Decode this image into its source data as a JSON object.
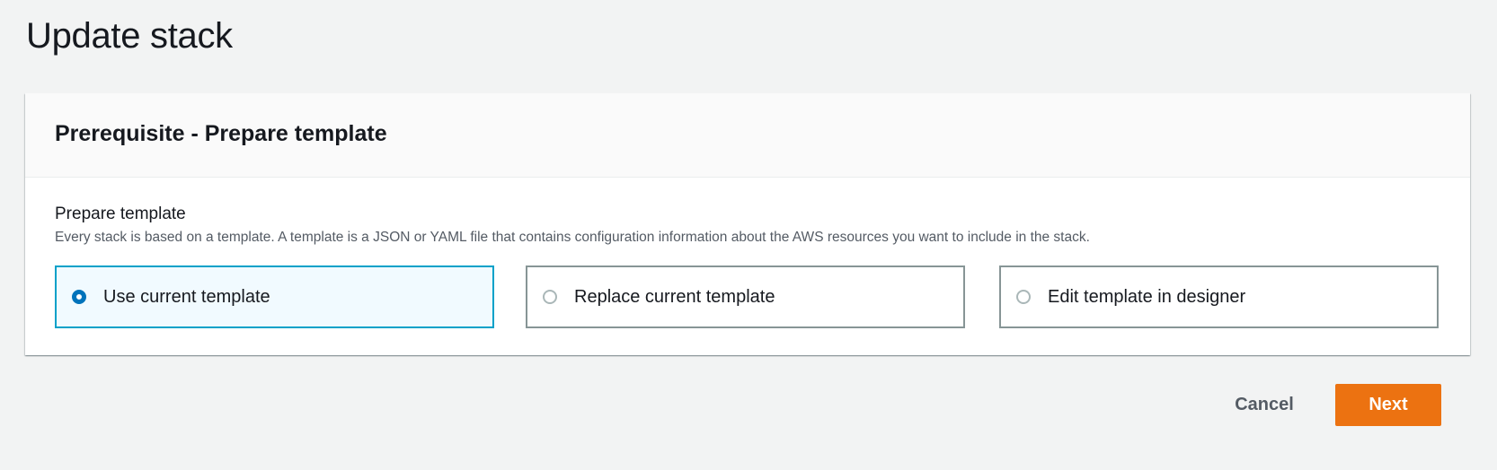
{
  "page": {
    "title": "Update stack"
  },
  "card": {
    "header": "Prerequisite - Prepare template",
    "field_label": "Prepare template",
    "field_description": "Every stack is based on a template. A template is a JSON or YAML file that contains configuration information about the AWS resources you want to include in the stack.",
    "options": [
      {
        "label": "Use current template",
        "selected": true
      },
      {
        "label": "Replace current template",
        "selected": false
      },
      {
        "label": "Edit template in designer",
        "selected": false
      }
    ]
  },
  "actions": {
    "cancel": "Cancel",
    "next": "Next"
  },
  "colors": {
    "accent": "#ec7211",
    "selected_border": "#00a1c9",
    "radio_selected": "#0073bb"
  }
}
